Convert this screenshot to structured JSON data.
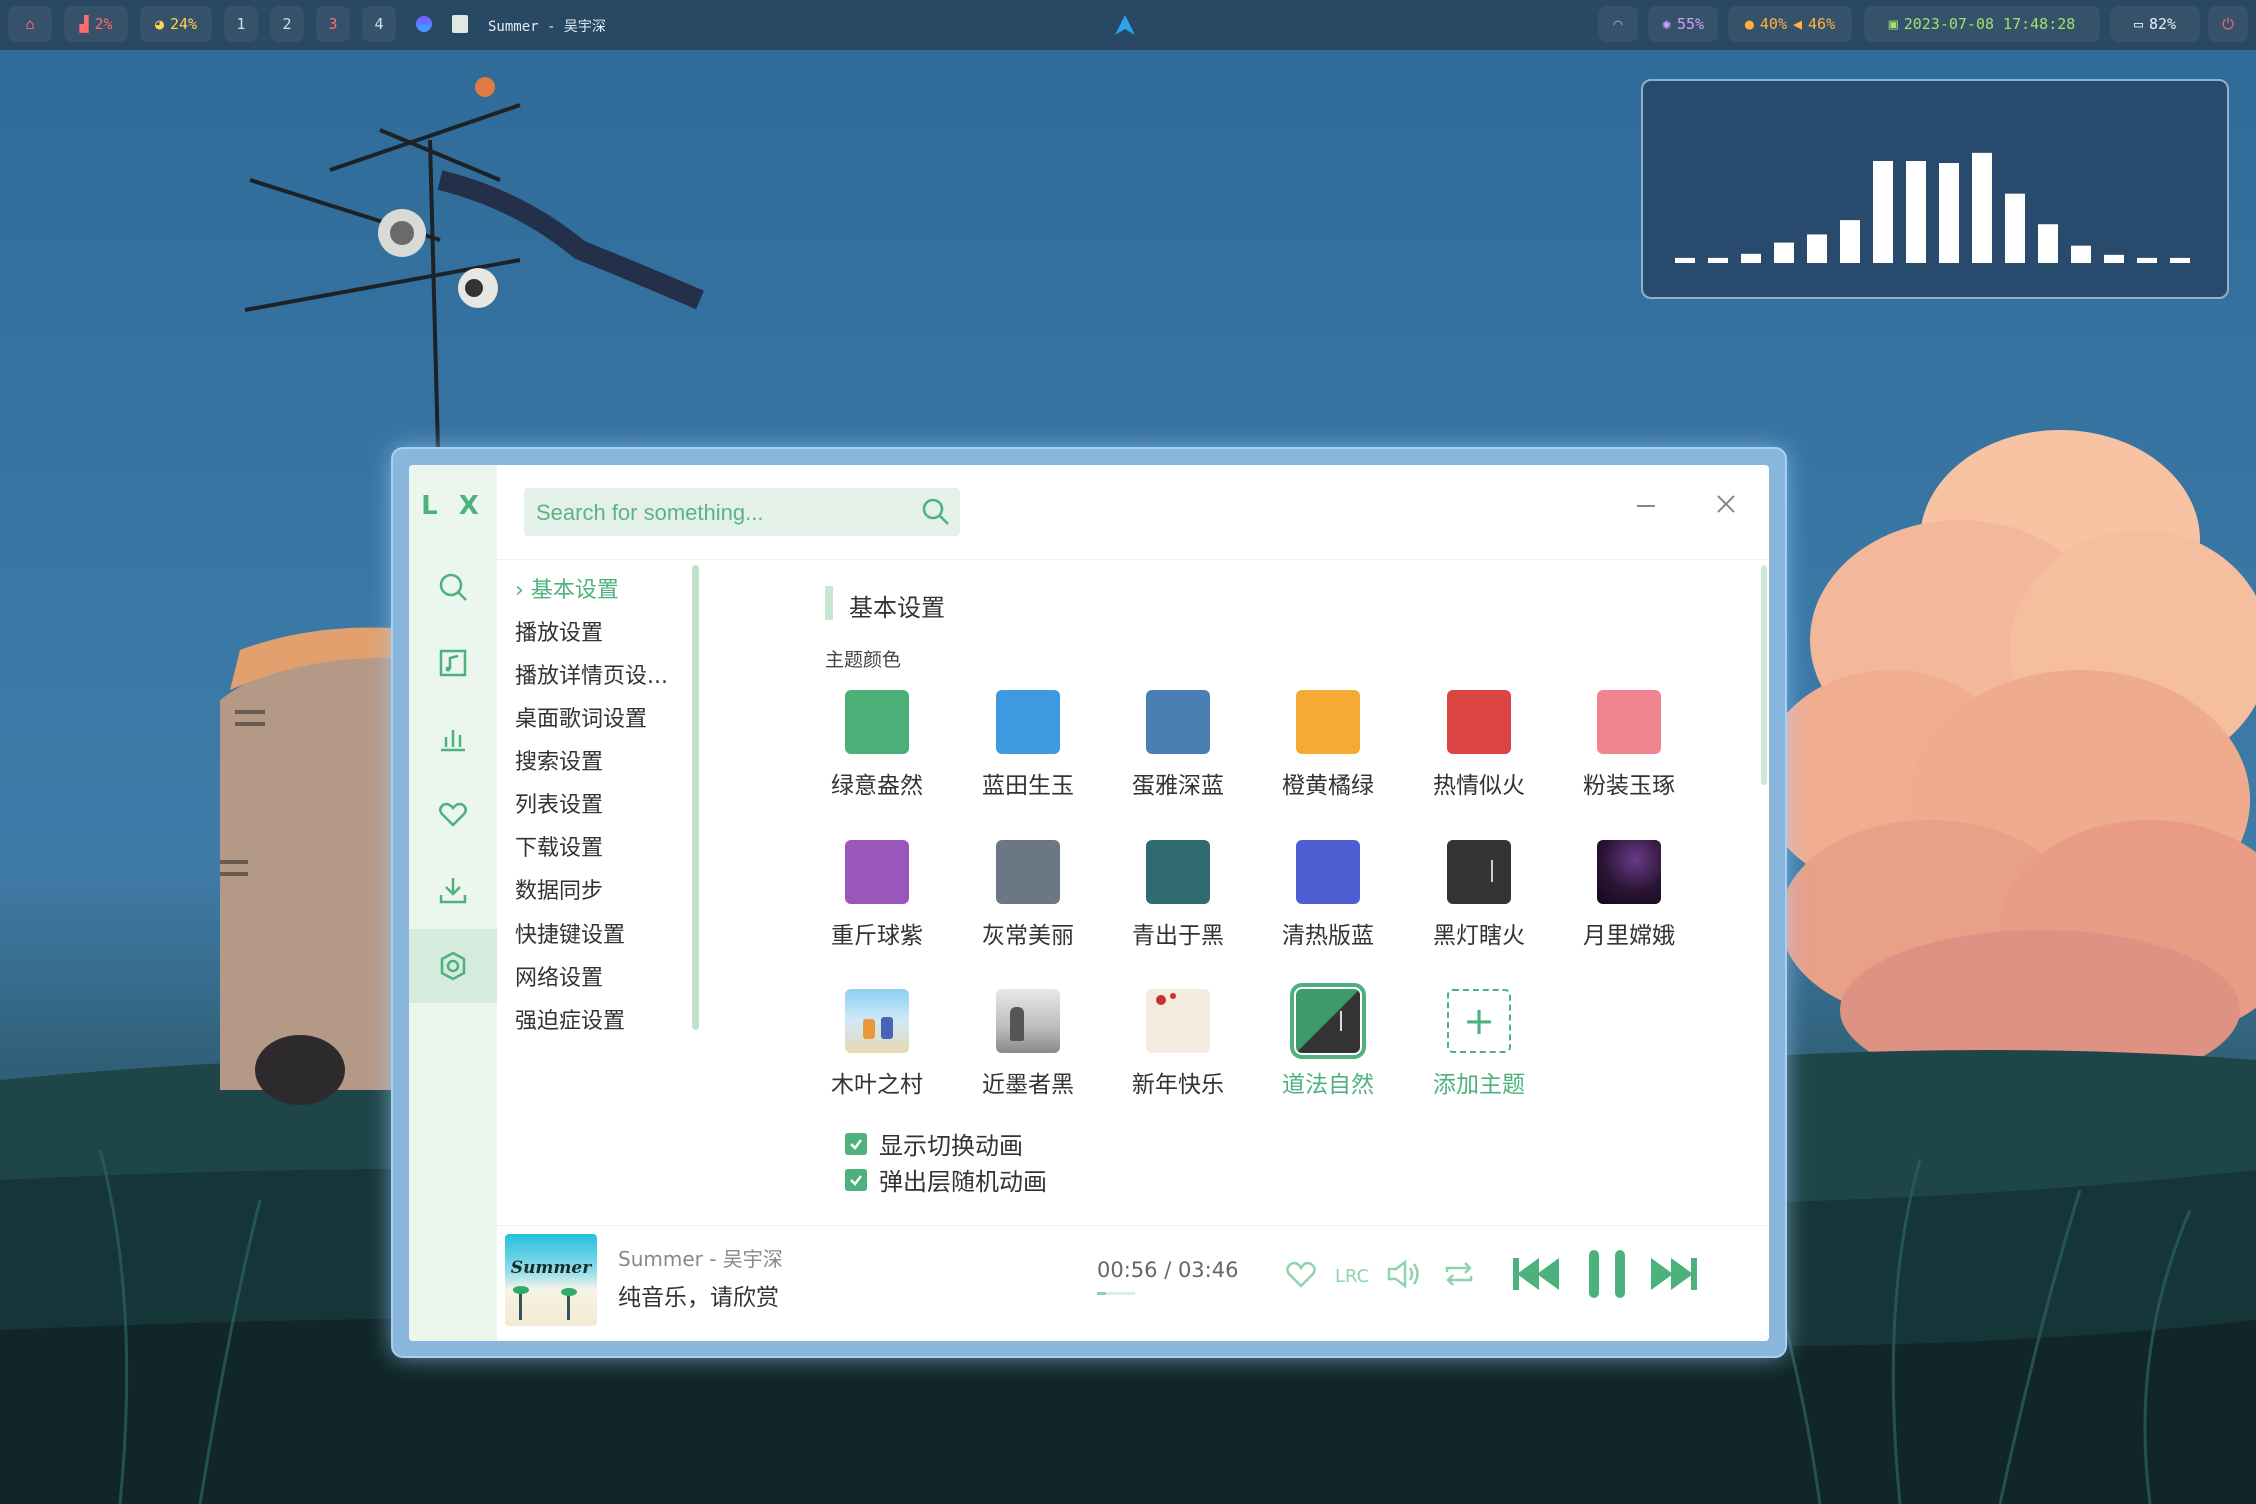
{
  "topbar": {
    "cpu": "2%",
    "mem": "24%",
    "workspaces": [
      "1",
      "2",
      "3",
      "4"
    ],
    "media_title": "Summer - 吴宇深",
    "brightness": "55%",
    "mic": "40%",
    "volume": "46%",
    "datetime": "2023-07-08 17:48:28",
    "battery": "82%"
  },
  "visualizer": {
    "levels": [
      0.05,
      0.05,
      0.09,
      0.2,
      0.28,
      0.42,
      1.0,
      1.0,
      0.98,
      1.08,
      0.68,
      0.38,
      0.17,
      0.08,
      0.05,
      0.05
    ]
  },
  "app": {
    "logo": "L X",
    "search_placeholder": "Search for something...",
    "menu": [
      "基本设置",
      "播放设置",
      "播放详情页设...",
      "桌面歌词设置",
      "搜索设置",
      "列表设置",
      "下载设置",
      "数据同步",
      "快捷键设置",
      "网络设置",
      "强迫症设置"
    ],
    "section_title": "基本设置",
    "theme_color_label": "主题颜色",
    "themes": [
      {
        "name": "绿意盎然",
        "color": "#4caf78"
      },
      {
        "name": "蓝田生玉",
        "color": "#3d9ae0"
      },
      {
        "name": "蛋雅深蓝",
        "color": "#4a7fb3"
      },
      {
        "name": "橙黄橘绿",
        "color": "#f5aa33"
      },
      {
        "name": "热情似火",
        "color": "#dc4444"
      },
      {
        "name": "粉装玉琢",
        "color": "#f08490"
      },
      {
        "name": "重斤球紫",
        "color": "#9b55bb"
      },
      {
        "name": "灰常美丽",
        "color": "#6b7785"
      },
      {
        "name": "青出于黑",
        "color": "#2f6b70"
      },
      {
        "name": "清热版蓝",
        "color": "#4e5fd2"
      },
      {
        "name": "黑灯瞎火",
        "color": "#333333"
      },
      {
        "name": "月里嫦娥",
        "color": "#2a1434"
      },
      {
        "name": "木叶之村",
        "color": "#9fd8f0"
      },
      {
        "name": "近墨者黑",
        "color": "#bdbdbd"
      },
      {
        "name": "新年快乐",
        "color": "#f4ebdf"
      },
      {
        "name": "道法自然",
        "color": "#3e9a6a"
      },
      {
        "name": "添加主题",
        "color": "#4db17d"
      }
    ],
    "checkboxes": [
      "显示切换动画",
      "弹出层随机动画"
    ],
    "player": {
      "cover_text": "Summer",
      "song": "Summer - 吴宇深",
      "lyric": "纯音乐，请欣赏",
      "time": "00:56 / 03:46",
      "progress": 0.248
    }
  }
}
